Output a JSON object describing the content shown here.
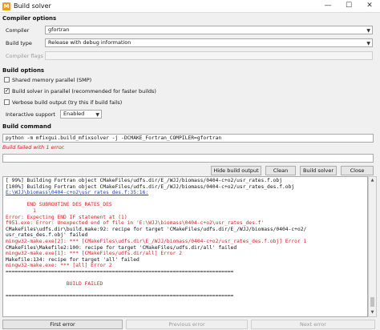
{
  "window": {
    "icon_glyph": "M",
    "title": "Build solver",
    "minimize": "—",
    "maximize": "☐",
    "close": "✕"
  },
  "compiler_options": {
    "title": "Compiler options",
    "compiler_label": "Compiler",
    "compiler_value": "gfortran",
    "build_type_label": "Build type",
    "build_type_value": "Release with debug information",
    "flags_label": "Compiler flags",
    "flags_value": ""
  },
  "build_options": {
    "title": "Build options",
    "shared_memory": {
      "label": "Shared memory parallel (SMP)",
      "checked": false
    },
    "parallel": {
      "label": "Build solver in parallel (recommended for faster builds)",
      "checked": true
    },
    "verbose": {
      "label": "Verbose build output (try this if build fails)",
      "checked": false
    },
    "interactive_label": "Interactive support",
    "interactive_value": "Enabled"
  },
  "build_command": {
    "title": "Build command",
    "command": "python -m mfixgui.build_mfixsolver -j -DCMAKE_Fortran_COMPILER=gfortran",
    "status": "Build failed with 1 error.",
    "extra_input": ""
  },
  "buttons": {
    "hide_output": "Hide build output",
    "clean": "Clean",
    "build_solver": "Build solver",
    "close": "Close",
    "first_error": "First error",
    "previous_error": "Previous error",
    "next_error": "Next error"
  },
  "colors": {
    "error_text": "#d42020",
    "link_text": "#1a3fc7",
    "normal_text": "#111111"
  },
  "log": [
    {
      "text": "[ 99%] Building Fortran object CMakeFiles/udfs.dir/E_/WJJ/biomass/0404-c+o2/usr_rates.f.obj",
      "style": "normal"
    },
    {
      "text": "[100%] Building Fortran object CMakeFiles/udfs.dir/E_/WJJ/biomass/0404-c+o2/usr_rates_des.f.obj",
      "style": "normal"
    },
    {
      "text": "E:\\WJJ\\biomass\\0404-c+o2\\usr_rates_des.f:35:16:",
      "style": "link"
    },
    {
      "text": "",
      "style": "normal"
    },
    {
      "text": "       END SUBROUTINE DES_RATES_DES",
      "style": "error"
    },
    {
      "text": "         1",
      "style": "error"
    },
    {
      "text": "Error: Expecting END IF statement at (1)",
      "style": "error"
    },
    {
      "text": "f951.exe: Error: Unexpected end of file in 'E:\\WJJ\\biomass\\0404-c+o2\\usr_rates_des.f'",
      "style": "error"
    },
    {
      "text": "CMakeFiles\\udfs.dir\\build.make:92: recipe for target 'CMakeFiles/udfs.dir/E_/WJJ/biomass/0404-c+o2/",
      "style": "normal"
    },
    {
      "text": "usr_rates_des.f.obj' failed",
      "style": "normal"
    },
    {
      "text": "mingw32-make.exe[2]: *** [CMakeFiles\\udfs.dir\\E_/WJJ/biomass/0404-c+o2/usr_rates_des.f.obj] Error 1",
      "style": "error"
    },
    {
      "text": "CMakeFiles\\Makefile2:100: recipe for target 'CMakeFiles/udfs.dir/all' failed",
      "style": "normal"
    },
    {
      "text": "mingw32-make.exe[1]: *** [CMakeFiles/udfs.dir/all] Error 2",
      "style": "error"
    },
    {
      "text": "Makefile:134: recipe for target 'all' failed",
      "style": "normal"
    },
    {
      "text": "mingw32-make.exe: *** [all] Error 2",
      "style": "error"
    },
    {
      "text": "===========================================================================",
      "style": "normal"
    },
    {
      "text": "",
      "style": "normal"
    },
    {
      "text": "                    BUILD FAILED",
      "style": "error"
    },
    {
      "text": "",
      "style": "normal"
    },
    {
      "text": "===========================================================================",
      "style": "normal"
    }
  ],
  "scrollbar": {
    "up": "▲",
    "down": "▼"
  }
}
